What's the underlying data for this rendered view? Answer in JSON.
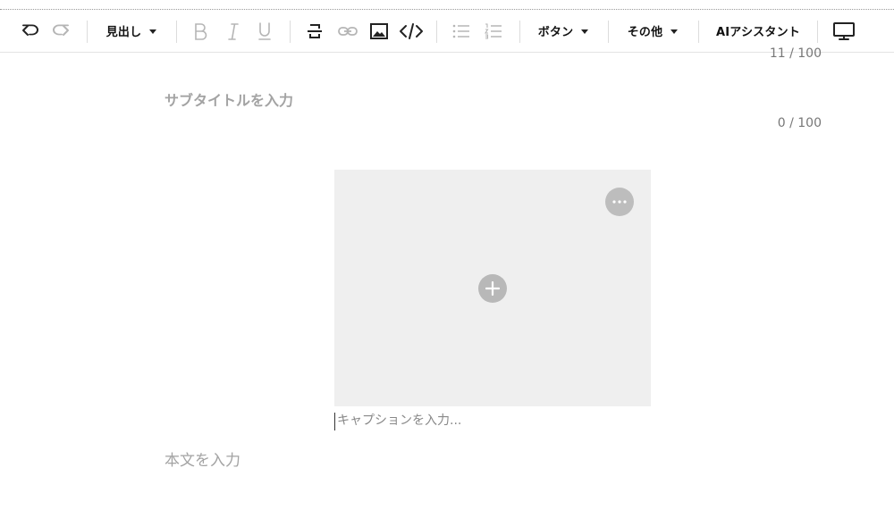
{
  "toolbar": {
    "heading_label": "見出し",
    "button_label": "ボタン",
    "other_label": "その他",
    "ai_assistant_label": "AIアシスタント"
  },
  "title_counter": "11 / 100",
  "subtitle": {
    "placeholder": "サブタイトルを入力",
    "counter": "0 / 100"
  },
  "image_block": {
    "caption_placeholder": "キャプションを入力..."
  },
  "body": {
    "placeholder": "本文を入力"
  },
  "colors": {
    "disabled_icon": "#b5b5b5",
    "active_icon": "#222222",
    "placeholder_text": "#a3a3a3",
    "image_bg": "#efefef"
  }
}
